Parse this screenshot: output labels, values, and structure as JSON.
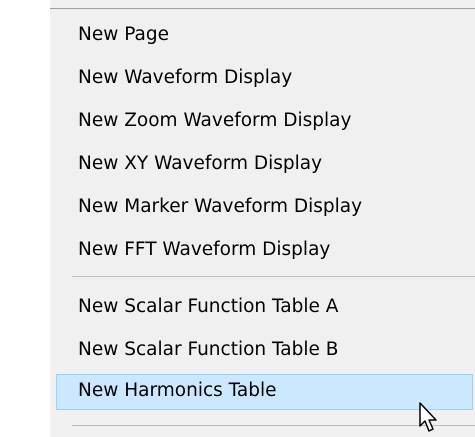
{
  "menu": {
    "items": [
      {
        "label": "New Page"
      },
      {
        "label": "New Waveform Display"
      },
      {
        "label": "New Zoom Waveform Display"
      },
      {
        "label": "New XY Waveform Display"
      },
      {
        "label": "New Marker Waveform Display"
      },
      {
        "label": "New FFT Waveform Display"
      },
      {
        "label": "New Scalar Function Table A"
      },
      {
        "label": "New Scalar Function Table B"
      },
      {
        "label": "New Harmonics Table"
      }
    ],
    "highlighted_item": "New Harmonics Table",
    "highlight_color": "#cce8ff",
    "highlight_border_color": "#99d1ff",
    "cursor_icon": "arrow-pointer-icon"
  }
}
